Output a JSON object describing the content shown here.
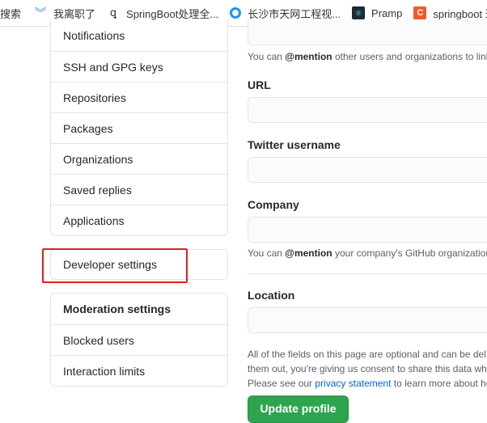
{
  "bookmarks": [
    {
      "label": "搜索",
      "icon": "none"
    },
    {
      "label": "我离职了",
      "icon": "chevrons-down-icon",
      "color": "#3b8be0"
    },
    {
      "label": "SpringBoot处理全...",
      "icon": "bird-icon"
    },
    {
      "label": "长沙市天网工程视...",
      "icon": "circle-logo-icon",
      "color": "#1e90ff"
    },
    {
      "label": "Pramp",
      "icon": "react-logo-icon"
    },
    {
      "label": "springboot 过",
      "icon": "csdn-c-icon",
      "color": "#f05a28"
    }
  ],
  "sidebar": {
    "group1": [
      "Notifications",
      "SSH and GPG keys",
      "Repositories",
      "Packages",
      "Organizations",
      "Saved replies",
      "Applications"
    ],
    "developer": "Developer settings",
    "moderation_header": "Moderation settings",
    "moderation": [
      "Blocked users",
      "Interaction limits"
    ]
  },
  "form": {
    "mention_note_pre": "You can ",
    "mention": "@mention",
    "mention_note_post": " other users and organizations to link",
    "url_label": "URL",
    "twitter_label": "Twitter username",
    "company_label": "Company",
    "company_note_pre": "You can ",
    "company_note_post": " your company's GitHub organization",
    "location_label": "Location",
    "para1": "All of the fields on this page are optional and can be del",
    "para2": "them out, you're giving us consent to share this data wh",
    "para3_pre": "Please see our ",
    "privacy_link": "privacy statement",
    "para3_post": " to learn more about ho",
    "update_button": "Update profile"
  }
}
